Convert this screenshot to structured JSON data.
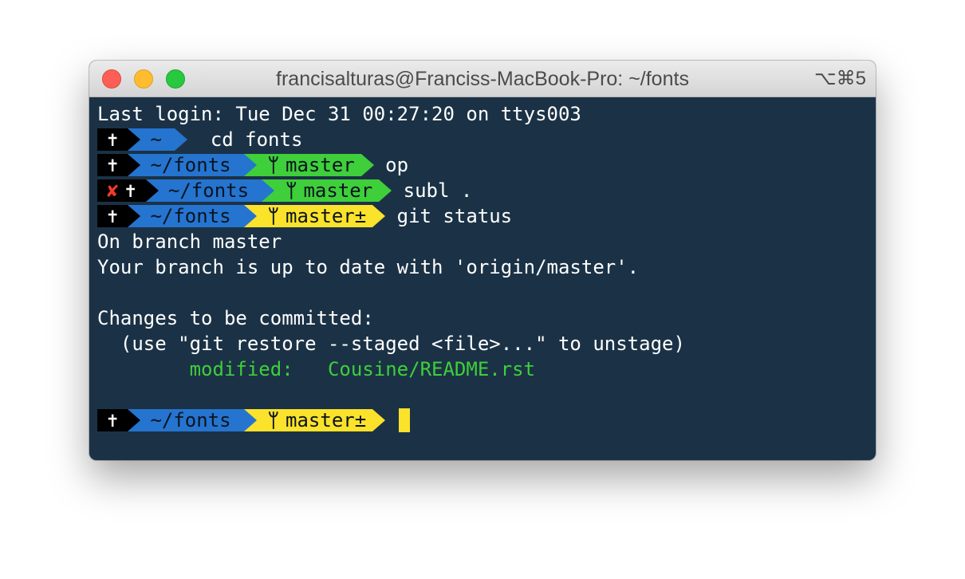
{
  "window": {
    "title": "francisalturas@Franciss-MacBook-Pro: ~/fonts",
    "shortcut": "⌥⌘5"
  },
  "terminal": {
    "last_login": "Last login: Tue Dec 31 00:27:20 on ttys003",
    "prompt_cross": "✝",
    "error_mark": "✘",
    "branch_glyph": "ᛘ",
    "line1": {
      "dir": "~",
      "cmd": "cd fonts"
    },
    "line2": {
      "dir": "~/fonts",
      "branch": "master",
      "cmd": "op"
    },
    "line3": {
      "dir": "~/fonts",
      "branch": "master",
      "cmd": "subl ."
    },
    "line4": {
      "dir": "~/fonts",
      "branch": "master±",
      "cmd": "git status"
    },
    "output": {
      "on_branch": "On branch master",
      "up_to_date": "Your branch is up to date with 'origin/master'.",
      "changes_header": "Changes to be committed:",
      "hint": "  (use \"git restore --staged <file>...\" to unstage)",
      "modified_label": "        modified:   ",
      "modified_file": "Cousine/README.rst"
    },
    "line5": {
      "dir": "~/fonts",
      "branch": "master±"
    }
  },
  "colors": {
    "background": "#1b3246",
    "dir_segment": "#2574cf",
    "git_clean": "#3ecf3a",
    "git_dirty": "#fbe22b",
    "error": "#ef3b2c"
  }
}
